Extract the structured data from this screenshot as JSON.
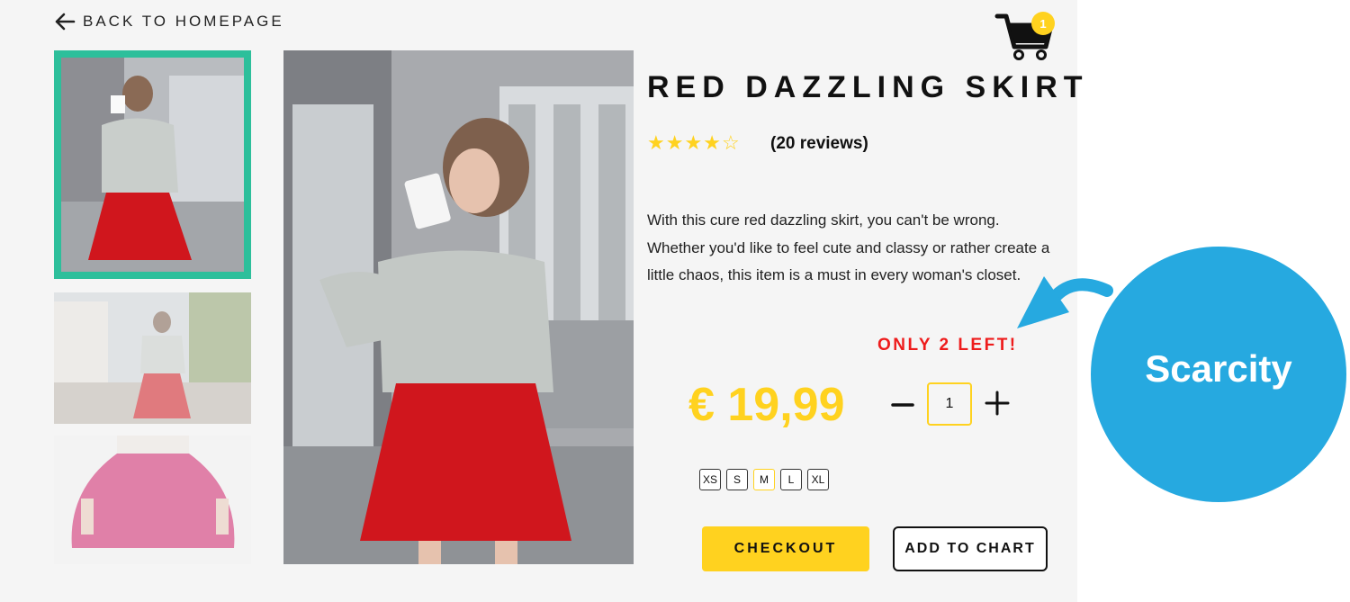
{
  "nav": {
    "back_label": "BACK TO HOMEPAGE"
  },
  "cart": {
    "count": "1"
  },
  "product": {
    "title": "RED DAZZLING SKIRT",
    "rating": {
      "value": 4,
      "max": 5,
      "reviews_label": "(20 reviews)"
    },
    "description": "With this cure red dazzling skirt, you can't be wrong. Whether you'd like to feel cute and classy or rather create a little chaos, this item is a must in every woman's closet.",
    "stock_notice": "ONLY 2 LEFT!",
    "price": "€ 19,99",
    "quantity": "1",
    "sizes": [
      "XS",
      "S",
      "M",
      "L",
      "XL"
    ],
    "selected_size": "M"
  },
  "actions": {
    "checkout_label": "CHECKOUT",
    "add_label": "ADD TO CHART"
  },
  "annotation": {
    "label": "Scarcity"
  },
  "colors": {
    "accent": "#ffd21f",
    "thumb_border": "#2dbf9b",
    "scarcity": "#ee1c1c",
    "bubble": "#26a9e0"
  },
  "icons": [
    "arrow-left-icon",
    "shopping-cart-icon",
    "star-icon",
    "minus-icon",
    "plus-icon"
  ]
}
